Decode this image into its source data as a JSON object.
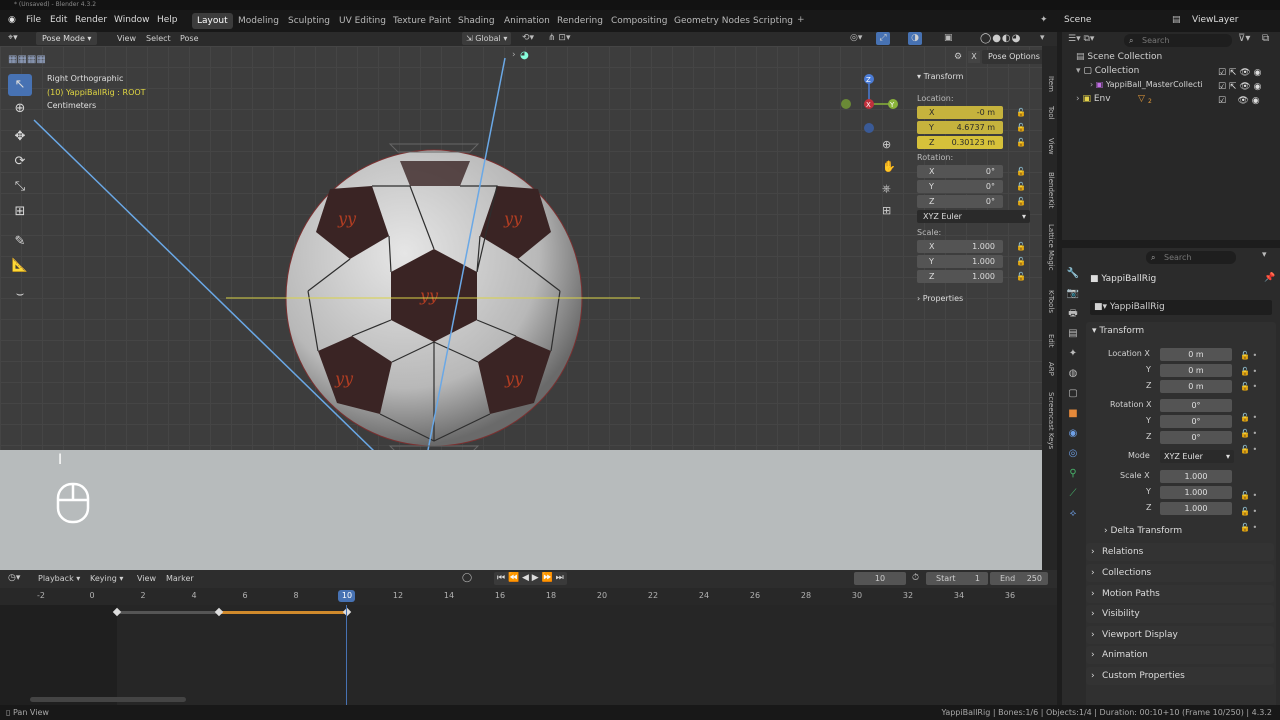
{
  "app": {
    "title": "* (Unsaved) - Blender 4.3.2"
  },
  "menus": [
    "File",
    "Edit",
    "Render",
    "Window",
    "Help"
  ],
  "workspaces": [
    "Layout",
    "Modeling",
    "Sculpting",
    "UV Editing",
    "Texture Paint",
    "Shading",
    "Animation",
    "Rendering",
    "Compositing",
    "Geometry Nodes",
    "Scripting"
  ],
  "active_workspace": "Layout",
  "scene": {
    "label": "Scene",
    "view_layer": "ViewLayer"
  },
  "viewport_header": {
    "mode": "Pose Mode",
    "view": "View",
    "select": "Select",
    "pose": "Pose",
    "orientation": "Global",
    "pose_options": "Pose Options"
  },
  "overlay": {
    "view_name": "Right Orthographic",
    "active": "(10) YappiBallRig : ROOT",
    "units": "Centimeters"
  },
  "npanel": {
    "title": "Transform",
    "location_label": "Location:",
    "location": [
      {
        "axis": "X",
        "value": "-0 m"
      },
      {
        "axis": "Y",
        "value": "4.6737 m"
      },
      {
        "axis": "Z",
        "value": "0.30123 m"
      }
    ],
    "rotation_label": "Rotation:",
    "rotation": [
      {
        "axis": "X",
        "value": "0°"
      },
      {
        "axis": "Y",
        "value": "0°"
      },
      {
        "axis": "Z",
        "value": "0°"
      }
    ],
    "rotation_mode": "XYZ Euler",
    "scale_label": "Scale:",
    "scale": [
      {
        "axis": "X",
        "value": "1.000"
      },
      {
        "axis": "Y",
        "value": "1.000"
      },
      {
        "axis": "Z",
        "value": "1.000"
      }
    ],
    "properties": "Properties",
    "tabs": [
      "Item",
      "Tool",
      "View",
      "BlenderKit",
      "Lattice Magic",
      "K-Tools",
      "Edit",
      "ARP",
      "Screencast Keys"
    ]
  },
  "outliner": {
    "search_placeholder": "Search",
    "items": [
      {
        "label": "Scene Collection"
      },
      {
        "label": "Collection"
      },
      {
        "label": "YappiBall_MasterCollecti"
      },
      {
        "label": "Env",
        "badge": "2"
      }
    ]
  },
  "properties": {
    "search_placeholder": "Search",
    "object_name": "YappiBallRig",
    "data_name": "YappiBallRig",
    "transform_title": "Transform",
    "location_label": "Location X",
    "location": [
      "0 m",
      "0 m",
      "0 m"
    ],
    "rotation_label": "Rotation X",
    "rotation": [
      "0°",
      "0°",
      "0°"
    ],
    "mode_label": "Mode",
    "mode": "XYZ Euler",
    "scale_label": "Scale X",
    "scale": [
      "1.000",
      "1.000",
      "1.000"
    ],
    "axis_y": "Y",
    "axis_z": "Z",
    "sections": [
      "Delta Transform",
      "Relations",
      "Collections",
      "Motion Paths",
      "Visibility",
      "Viewport Display",
      "Animation",
      "Custom Properties"
    ]
  },
  "timeline": {
    "menus": [
      "Playback",
      "Keying",
      "View",
      "Marker"
    ],
    "current_frame": "10",
    "start_label": "Start",
    "start": "1",
    "end_label": "End",
    "end": "250",
    "ruler": [
      "-2",
      "0",
      "2",
      "4",
      "6",
      "8",
      "10",
      "12",
      "14",
      "16",
      "18",
      "20",
      "22",
      "24",
      "26",
      "28",
      "30",
      "32",
      "34",
      "36"
    ],
    "playhead": "10"
  },
  "status": {
    "left": "Pan View",
    "right": "YappiBallRig | Bones:1/6 | Objects:1/4 | Duration: 00:10+10 (Frame 10/250) | 4.3.2"
  }
}
